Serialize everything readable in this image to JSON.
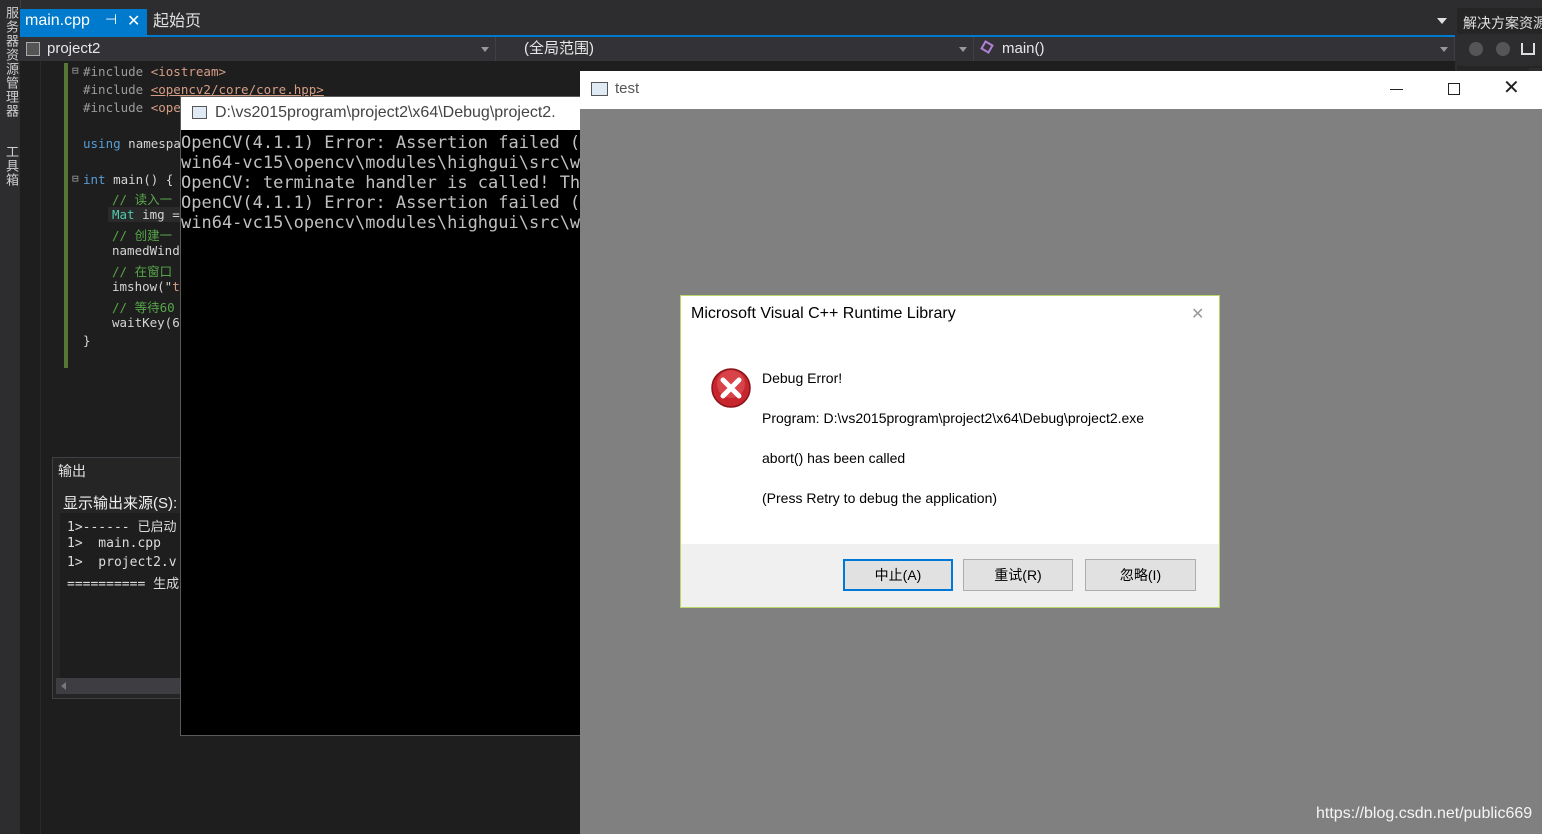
{
  "ide": {
    "left_strip": {
      "tab1": "服务器资源管理器",
      "tab2": "工具箱"
    },
    "tabs": {
      "active": "main.cpp",
      "pin_glyph": "⊣",
      "close_glyph": "✕",
      "inactive": "起始页"
    },
    "nav": {
      "project": "project2",
      "scope": "(全局范围)",
      "member": "main()"
    },
    "code_lines": [
      {
        "t": "#include ",
        "s": "<iostream>"
      },
      {
        "t": "#include ",
        "s": "<opencv2/core/core.hpp>"
      },
      {
        "t": "#include ",
        "s": "<ope"
      },
      {
        "k": "using",
        "t": " namespa"
      },
      {
        "k": "int",
        "t": " main() {"
      },
      {
        "c": "// 读入一"
      },
      {
        "ty": "Mat",
        "t": " img ="
      },
      {
        "c": "// 创建一"
      },
      {
        "t": "namedWindo"
      },
      {
        "c": "// 在窗口"
      },
      {
        "t": "imshow(\"",
        "s": "te"
      },
      {
        "c": "// 等待60"
      },
      {
        "t": "waitKey(6("
      },
      {
        "t": "}"
      }
    ],
    "output": {
      "title": "输出",
      "source_label": "显示输出来源(S):",
      "lines": [
        "1>------ 已启动",
        "1>  main.cpp",
        "1>  project2.v",
        "========== 生成"
      ]
    },
    "solution_title": "解决方案资源"
  },
  "console": {
    "title": "D:\\vs2015program\\project2\\x64\\Debug\\project2.",
    "lines": [
      "OpenCV(4.1.1) Error: Assertion failed (s",
      "win64-vc15\\opencv\\modules\\highgui\\src\\wi",
      "OpenCV: terminate handler is called! The",
      "OpenCV(4.1.1) Error: Assertion failed (s",
      "win64-vc15\\opencv\\modules\\highgui\\src\\wi"
    ]
  },
  "testwin": {
    "title": "test"
  },
  "dialog": {
    "title": "Microsoft Visual C++ Runtime Library",
    "heading": "Debug Error!",
    "program": "Program: D:\\vs2015program\\project2\\x64\\Debug\\project2.exe",
    "message": "abort() has been called",
    "hint": "(Press Retry to debug the application)",
    "buttons": {
      "abort": "中止(A)",
      "retry": "重试(R)",
      "ignore": "忽略(I)"
    }
  },
  "watermark": "https://blog.csdn.net/public669"
}
